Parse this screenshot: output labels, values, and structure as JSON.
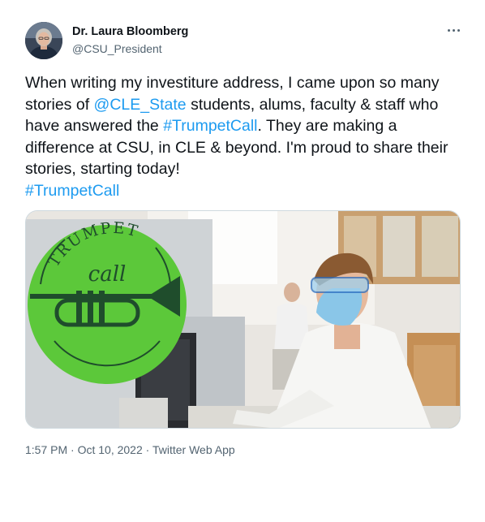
{
  "author": {
    "name": "Dr. Laura Bloomberg",
    "handle": "@CSU_President"
  },
  "tweet": {
    "segments": [
      {
        "text": "When writing my investiture address, I came upon so many stories of ",
        "link": false
      },
      {
        "text": "@CLE_State",
        "link": true
      },
      {
        "text": " students, alums, faculty & staff who have answered the ",
        "link": false
      },
      {
        "text": "#TrumpetCall",
        "link": true
      },
      {
        "text": ". They are making a difference at CSU, in CLE & beyond. I'm proud to share their stories, starting today!\n",
        "link": false
      },
      {
        "text": "#TrumpetCall",
        "link": true
      }
    ]
  },
  "media": {
    "logo_top": "TRUMPET",
    "logo_word": "call"
  },
  "meta": {
    "time": "1:57 PM",
    "sep1": " · ",
    "date": "Oct 10, 2022",
    "sep2": " · ",
    "app": "Twitter Web App"
  },
  "colors": {
    "link": "#1d9bf0",
    "logo_green": "#5cc83a",
    "logo_ink": "#1f4d2c"
  },
  "icons": {
    "more": "more-horizontal-icon"
  }
}
